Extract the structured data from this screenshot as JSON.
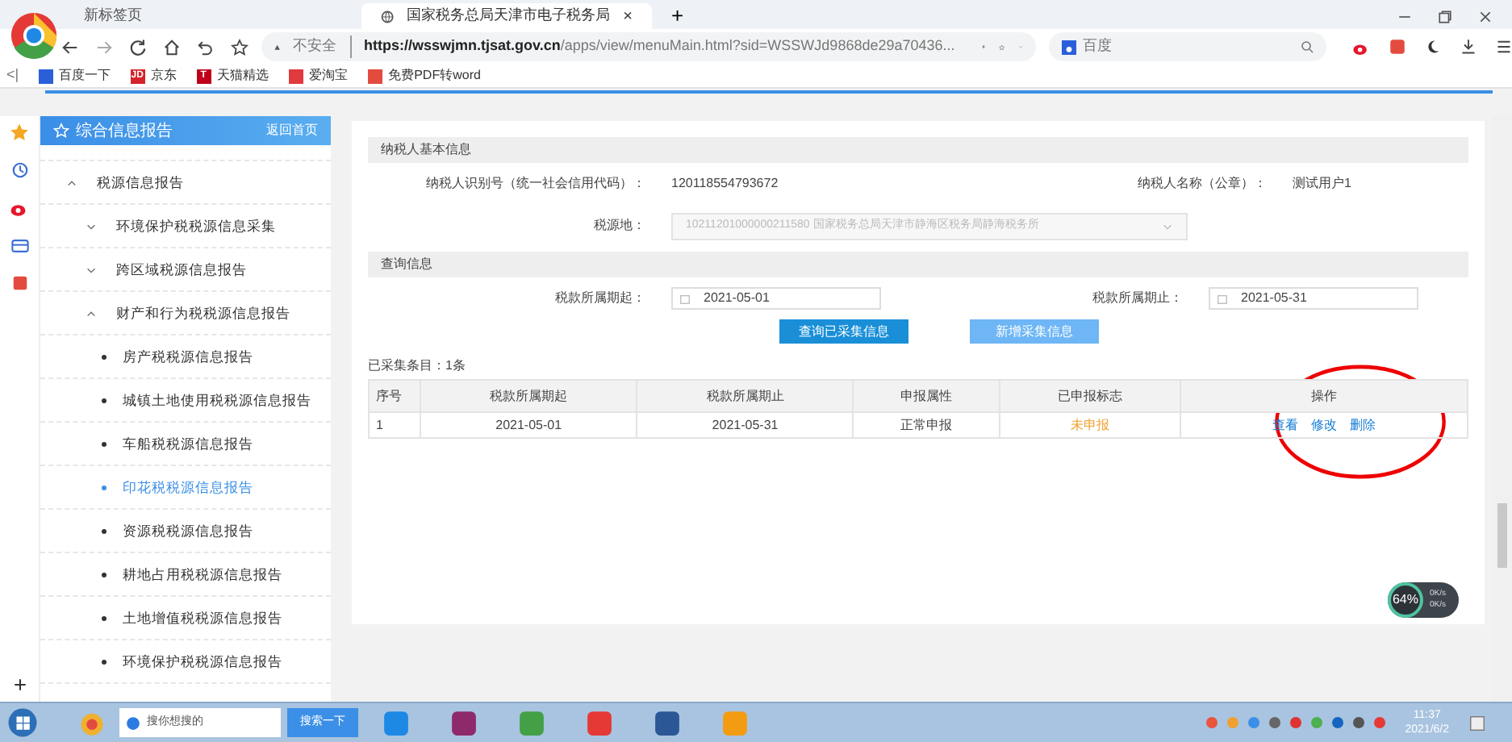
{
  "browser": {
    "tabs": [
      {
        "title": "新标签页",
        "selected": false
      },
      {
        "title": "国家税务总局天津市电子税务局",
        "selected": true,
        "close": "×"
      }
    ],
    "new_tab": "+",
    "security": "不安全",
    "url_host": "https://wsswjmn.tjsat.gov.cn",
    "url_path": "/apps/view/menuMain.html?sid=WSSWJd9868de29a70436...",
    "search_engine": "百度",
    "sidebar_toggle": "<|",
    "bookmarks": [
      {
        "label": "百度一下",
        "color": "#2b5fd9"
      },
      {
        "label": "京东",
        "icon_text": "JD",
        "color": "#d4232b"
      },
      {
        "label": "天猫精选",
        "icon_text": "T",
        "color": "#c0001a"
      },
      {
        "label": "爱淘宝",
        "color": "#e0393e"
      },
      {
        "label": "免费PDF转word",
        "color": "#e34b3f"
      }
    ]
  },
  "sidebar": {
    "title": "综合信息报告",
    "home_link": "返回首页",
    "tree": [
      {
        "label": "税源信息报告",
        "expanded": true,
        "children": [
          {
            "label": "环境保护税税源信息采集",
            "expanded": false
          },
          {
            "label": "跨区域税源信息报告",
            "expanded": false
          },
          {
            "label": "财产和行为税税源信息报告",
            "expanded": true,
            "children": [
              {
                "label": "房产税税源信息报告",
                "selected": false
              },
              {
                "label": "城镇土地使用税税源信息报告",
                "selected": false
              },
              {
                "label": "车船税税源信息报告",
                "selected": false
              },
              {
                "label": "印花税税源信息报告",
                "selected": true
              },
              {
                "label": "资源税税源信息报告",
                "selected": false
              },
              {
                "label": "耕地占用税税源信息报告",
                "selected": false
              },
              {
                "label": "土地增值税税源信息报告",
                "selected": false
              },
              {
                "label": "环境保护税税源信息报告",
                "selected": false
              }
            ]
          }
        ]
      }
    ]
  },
  "taxpayer": {
    "heading": "纳税人基本信息",
    "id_label": "纳税人识别号（统一社会信用代码）：",
    "id_value": "120118554793672",
    "name_label": "纳税人名称（公章）：",
    "name_value": "测试用户1",
    "source_label": "税源地：",
    "source_value": "10211201000000211580 国家税务总局天津市静海区税务局静海税务所",
    "source_disabled": true
  },
  "query": {
    "heading": "查询信息",
    "start_label": "税款所属期起：",
    "start_value": "2021-05-01",
    "end_label": "税款所属期止：",
    "end_value": "2021-05-31",
    "buttons": [
      {
        "label": "查询已采集信息",
        "kind": "primary"
      },
      {
        "label": "新增采集信息",
        "kind": "light"
      }
    ]
  },
  "results": {
    "count": "已采集条目：1条",
    "columns": [
      "序号",
      "税款所属期起",
      "税款所属期止",
      "申报属性",
      "已申报标志",
      "操作"
    ],
    "rows": [
      {
        "index": "1",
        "start": "2021-05-01",
        "end": "2021-05-31",
        "attribute": "正常申报",
        "status": "未申报",
        "actions": [
          "查看",
          "修改",
          "删除"
        ]
      }
    ]
  },
  "widget": {
    "percent": "64%",
    "rates": [
      "0K/s",
      "0K/s"
    ]
  },
  "taskbar": {
    "search_placeholder": "搜你想搜的",
    "search_button": "搜索一下",
    "time": "11:37",
    "date": "2021/6/2"
  }
}
